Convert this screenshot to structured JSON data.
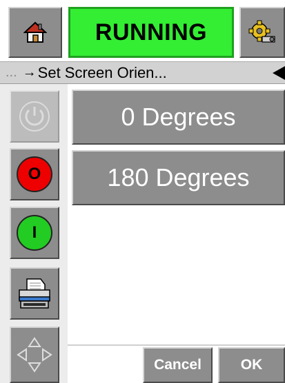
{
  "header": {
    "status_text": "RUNNING",
    "status_color": "#33ee33",
    "home_icon": "home-icon",
    "settings_icon": "settings-gear-icon"
  },
  "breadcrumb": {
    "prefix": "...",
    "arrow": "→",
    "title": "Set Screen Orien..."
  },
  "sidebar": {
    "stop_label": "O",
    "start_label": "I",
    "stop_color": "#ee0000",
    "start_color": "#22cc22"
  },
  "options": [
    {
      "label": "0 Degrees"
    },
    {
      "label": "180 Degrees"
    }
  ],
  "footer": {
    "cancel_label": "Cancel",
    "ok_label": "OK"
  }
}
